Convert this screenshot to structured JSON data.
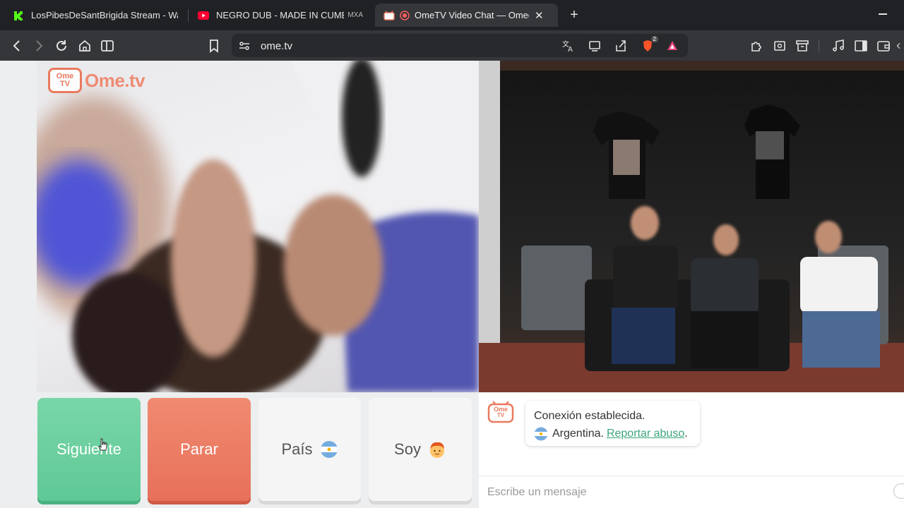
{
  "browser": {
    "tabs": [
      {
        "title": "LosPibesDeSantBrigida Stream - Wat",
        "icon": "kick-icon",
        "active": false
      },
      {
        "title": "NEGRO DUB - MADE IN CUMBIA",
        "title_suffix": "MXA",
        "icon": "youtube-icon",
        "active": false
      },
      {
        "title": "OmeTV Video Chat — Omegl",
        "icon": "ometv-icon",
        "active": true,
        "recording": true
      }
    ],
    "address_bar": {
      "url": "ome.tv"
    },
    "brave_shield_count": "2",
    "colors": {
      "tabbar": "#202124",
      "toolbar": "#35363a"
    }
  },
  "ome": {
    "logo": {
      "tv_top": "Ome",
      "tv_bottom": "TV",
      "wordmark": "Ome.tv"
    },
    "buttons": {
      "next": "Siguiente",
      "stop": "Parar",
      "country": "País",
      "gender": "Soy"
    },
    "chat": {
      "avatar_top": "Ome",
      "avatar_bottom": "TV",
      "connected": "Conexión establecida.",
      "country": "Argentina.",
      "report_link": "Reportar abuso",
      "report_suffix": ".",
      "input_placeholder": "Escribe un mensaje"
    },
    "colors": {
      "next": "#6ccf9e",
      "stop": "#ec7c64",
      "link": "#3da67a",
      "brand": "#e97a5e"
    }
  }
}
